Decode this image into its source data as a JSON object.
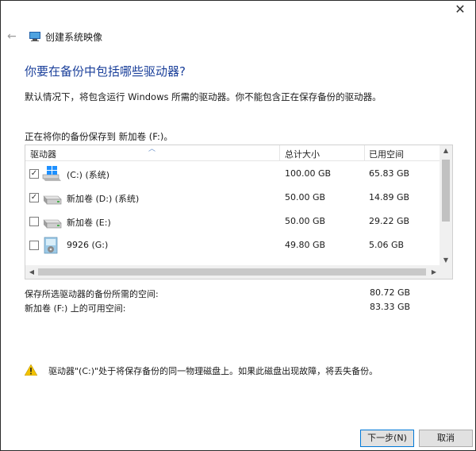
{
  "window": {
    "close_glyph": "✕",
    "back_glyph": "←",
    "title": "创建系统映像"
  },
  "page": {
    "heading": "你要在备份中包括哪些驱动器?",
    "description": "默认情况下，将包含运行 Windows 所需的驱动器。你不能包含正在保存备份的驱动器。",
    "save_to": "正在将你的备份保存到 新加卷 (F:)。"
  },
  "table": {
    "columns": [
      "驱动器",
      "总计大小",
      "已用空间"
    ],
    "rows": [
      {
        "name": "(C:) (系统)",
        "total": "100.00 GB",
        "used": "65.83 GB",
        "checked": true,
        "icon": "windows-drive-icon"
      },
      {
        "name": "新加卷 (D:) (系统)",
        "total": "50.00 GB",
        "used": "14.89 GB",
        "checked": true,
        "icon": "hard-drive-icon"
      },
      {
        "name": "新加卷 (E:)",
        "total": "50.00 GB",
        "used": "29.22 GB",
        "checked": false,
        "icon": "hard-drive-icon"
      },
      {
        "name": "9926 (G:)",
        "total": "49.80 GB",
        "used": "5.06 GB",
        "checked": false,
        "icon": "dvd-drive-icon"
      }
    ]
  },
  "summary": {
    "required_label": "保存所选驱动器的备份所需的空间:",
    "required_value": "80.72 GB",
    "available_label": "新加卷 (F:) 上的可用空间:",
    "available_value": "83.33 GB"
  },
  "warning": {
    "text": "驱动器\"(C:)\"处于将保存备份的同一物理磁盘上。如果此磁盘出现故障，将丢失备份。"
  },
  "buttons": {
    "next": "下一步(N)",
    "cancel": "取消"
  },
  "colors": {
    "heading": "#1a3f9a",
    "accent": "#0078d7"
  }
}
